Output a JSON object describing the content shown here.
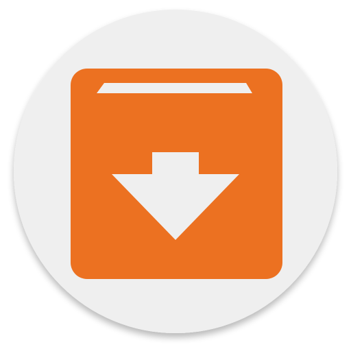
{
  "icon": {
    "name": "archive-download-icon",
    "background_color": "#EFEFEF",
    "box_color": "#EC7121",
    "glyph_color": "#EFEFEF"
  }
}
